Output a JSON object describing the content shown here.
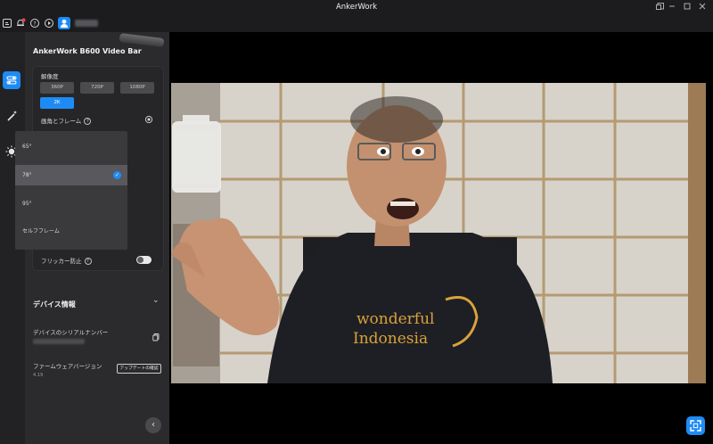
{
  "window": {
    "title": "AnkerWork",
    "controls": [
      "restore-down",
      "minimize",
      "maximize",
      "close"
    ]
  },
  "toolbar": {
    "icons": [
      "screen-share-icon",
      "notification-bell-icon",
      "help-icon",
      "video-play-icon"
    ],
    "notification_dot_color": "#e5484d",
    "user_avatar_color": "#1e8bf5"
  },
  "rail": {
    "items": [
      "camera-settings",
      "beauty-wand",
      "lighting"
    ],
    "active_color": "#1e8bf5"
  },
  "device": {
    "title": "AnkerWork B600 Video Bar"
  },
  "resolution": {
    "label": "解像度",
    "options": [
      "360P",
      "720P",
      "1080P",
      "2K"
    ],
    "selected": "2K"
  },
  "fov": {
    "label": "画角とフレーム",
    "help": "?",
    "options": [
      "65°",
      "78°",
      "95°",
      "セルフフレーム"
    ],
    "selected": "78°",
    "check": "✓"
  },
  "flicker": {
    "label": "フリッカー防止",
    "help": "?",
    "enabled": false
  },
  "device_info": {
    "title": "デバイス情報",
    "chevron": "⌄",
    "serial_label": "デバイスのシリアルナンバー",
    "firmware_label": "ファームウェアバージョン",
    "firmware_version": "4.19",
    "update_button": "アップデートの確認"
  },
  "panel": {
    "collapse": "‹"
  },
  "preview": {
    "shirt_text_line1": "wonderful",
    "shirt_text_line2": "Indonesia"
  }
}
